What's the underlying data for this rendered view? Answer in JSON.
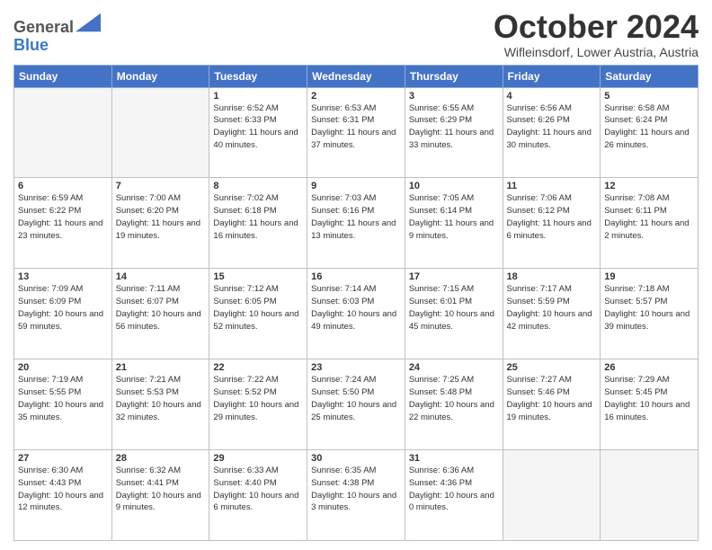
{
  "header": {
    "logo_line1": "General",
    "logo_line2": "Blue",
    "month": "October 2024",
    "location": "Wifleinsdorf, Lower Austria, Austria"
  },
  "weekdays": [
    "Sunday",
    "Monday",
    "Tuesday",
    "Wednesday",
    "Thursday",
    "Friday",
    "Saturday"
  ],
  "weeks": [
    [
      {
        "day": "",
        "info": ""
      },
      {
        "day": "",
        "info": ""
      },
      {
        "day": "1",
        "info": "Sunrise: 6:52 AM\nSunset: 6:33 PM\nDaylight: 11 hours and 40 minutes."
      },
      {
        "day": "2",
        "info": "Sunrise: 6:53 AM\nSunset: 6:31 PM\nDaylight: 11 hours and 37 minutes."
      },
      {
        "day": "3",
        "info": "Sunrise: 6:55 AM\nSunset: 6:29 PM\nDaylight: 11 hours and 33 minutes."
      },
      {
        "day": "4",
        "info": "Sunrise: 6:56 AM\nSunset: 6:26 PM\nDaylight: 11 hours and 30 minutes."
      },
      {
        "day": "5",
        "info": "Sunrise: 6:58 AM\nSunset: 6:24 PM\nDaylight: 11 hours and 26 minutes."
      }
    ],
    [
      {
        "day": "6",
        "info": "Sunrise: 6:59 AM\nSunset: 6:22 PM\nDaylight: 11 hours and 23 minutes."
      },
      {
        "day": "7",
        "info": "Sunrise: 7:00 AM\nSunset: 6:20 PM\nDaylight: 11 hours and 19 minutes."
      },
      {
        "day": "8",
        "info": "Sunrise: 7:02 AM\nSunset: 6:18 PM\nDaylight: 11 hours and 16 minutes."
      },
      {
        "day": "9",
        "info": "Sunrise: 7:03 AM\nSunset: 6:16 PM\nDaylight: 11 hours and 13 minutes."
      },
      {
        "day": "10",
        "info": "Sunrise: 7:05 AM\nSunset: 6:14 PM\nDaylight: 11 hours and 9 minutes."
      },
      {
        "day": "11",
        "info": "Sunrise: 7:06 AM\nSunset: 6:12 PM\nDaylight: 11 hours and 6 minutes."
      },
      {
        "day": "12",
        "info": "Sunrise: 7:08 AM\nSunset: 6:11 PM\nDaylight: 11 hours and 2 minutes."
      }
    ],
    [
      {
        "day": "13",
        "info": "Sunrise: 7:09 AM\nSunset: 6:09 PM\nDaylight: 10 hours and 59 minutes."
      },
      {
        "day": "14",
        "info": "Sunrise: 7:11 AM\nSunset: 6:07 PM\nDaylight: 10 hours and 56 minutes."
      },
      {
        "day": "15",
        "info": "Sunrise: 7:12 AM\nSunset: 6:05 PM\nDaylight: 10 hours and 52 minutes."
      },
      {
        "day": "16",
        "info": "Sunrise: 7:14 AM\nSunset: 6:03 PM\nDaylight: 10 hours and 49 minutes."
      },
      {
        "day": "17",
        "info": "Sunrise: 7:15 AM\nSunset: 6:01 PM\nDaylight: 10 hours and 45 minutes."
      },
      {
        "day": "18",
        "info": "Sunrise: 7:17 AM\nSunset: 5:59 PM\nDaylight: 10 hours and 42 minutes."
      },
      {
        "day": "19",
        "info": "Sunrise: 7:18 AM\nSunset: 5:57 PM\nDaylight: 10 hours and 39 minutes."
      }
    ],
    [
      {
        "day": "20",
        "info": "Sunrise: 7:19 AM\nSunset: 5:55 PM\nDaylight: 10 hours and 35 minutes."
      },
      {
        "day": "21",
        "info": "Sunrise: 7:21 AM\nSunset: 5:53 PM\nDaylight: 10 hours and 32 minutes."
      },
      {
        "day": "22",
        "info": "Sunrise: 7:22 AM\nSunset: 5:52 PM\nDaylight: 10 hours and 29 minutes."
      },
      {
        "day": "23",
        "info": "Sunrise: 7:24 AM\nSunset: 5:50 PM\nDaylight: 10 hours and 25 minutes."
      },
      {
        "day": "24",
        "info": "Sunrise: 7:25 AM\nSunset: 5:48 PM\nDaylight: 10 hours and 22 minutes."
      },
      {
        "day": "25",
        "info": "Sunrise: 7:27 AM\nSunset: 5:46 PM\nDaylight: 10 hours and 19 minutes."
      },
      {
        "day": "26",
        "info": "Sunrise: 7:29 AM\nSunset: 5:45 PM\nDaylight: 10 hours and 16 minutes."
      }
    ],
    [
      {
        "day": "27",
        "info": "Sunrise: 6:30 AM\nSunset: 4:43 PM\nDaylight: 10 hours and 12 minutes."
      },
      {
        "day": "28",
        "info": "Sunrise: 6:32 AM\nSunset: 4:41 PM\nDaylight: 10 hours and 9 minutes."
      },
      {
        "day": "29",
        "info": "Sunrise: 6:33 AM\nSunset: 4:40 PM\nDaylight: 10 hours and 6 minutes."
      },
      {
        "day": "30",
        "info": "Sunrise: 6:35 AM\nSunset: 4:38 PM\nDaylight: 10 hours and 3 minutes."
      },
      {
        "day": "31",
        "info": "Sunrise: 6:36 AM\nSunset: 4:36 PM\nDaylight: 10 hours and 0 minutes."
      },
      {
        "day": "",
        "info": ""
      },
      {
        "day": "",
        "info": ""
      }
    ]
  ]
}
